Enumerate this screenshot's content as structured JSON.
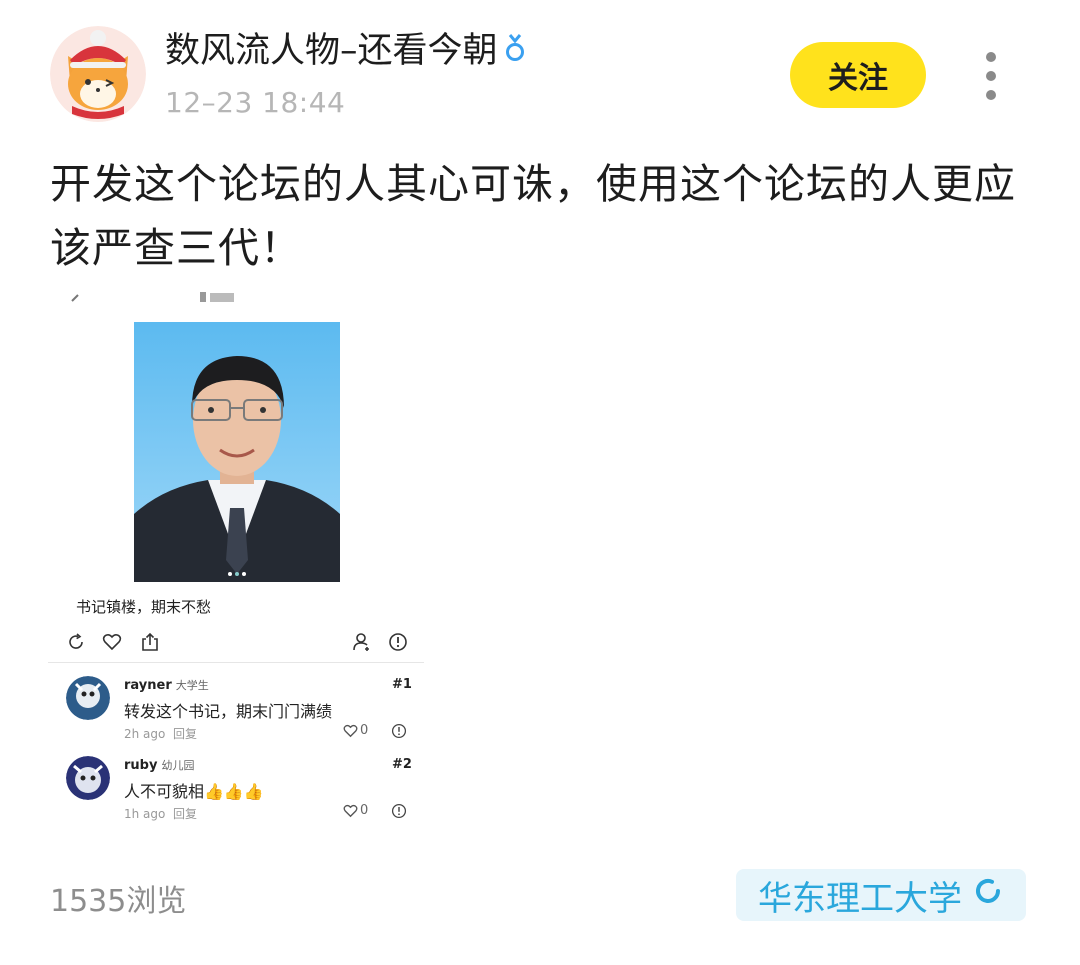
{
  "post": {
    "author": "数风流人物–还看今朝",
    "time": "12–23 18:44",
    "follow_label": "关注",
    "text": "开发这个论坛的人其心可诛，使用这个论坛的人更应该严查三代！",
    "views": "1535浏览",
    "school_tag": "华东理工大学"
  },
  "embedded": {
    "caption": "书记镇楼，期末不愁",
    "comments": [
      {
        "user": "rayner",
        "level": "大学生",
        "num": "#1",
        "text": "转发这个书记，期末门门满绩",
        "time": "2h ago",
        "reply": "回复",
        "likes": "0"
      },
      {
        "user": "ruby",
        "level": "幼儿园",
        "num": "#2",
        "text": "人不可貌相👍👍👍",
        "time": "1h ago",
        "reply": "回复",
        "likes": "0"
      }
    ]
  },
  "colors": {
    "follow_bg": "#ffe21c",
    "tag_bg": "#e7f5fb",
    "tag_text": "#2aa7dc"
  },
  "icons": [
    "fox-avatar",
    "male-icon",
    "more-icon",
    "refresh-icon",
    "heart-icon",
    "share-icon",
    "add-user-icon",
    "report-icon",
    "loading-icon"
  ]
}
